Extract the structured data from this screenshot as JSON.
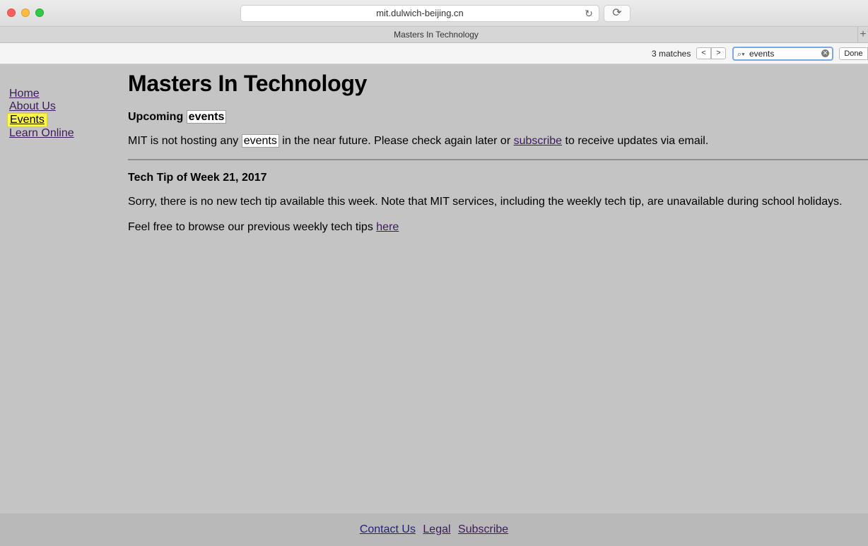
{
  "browser": {
    "url": "mit.dulwich-beijing.cn",
    "tab_title": "Masters In Technology",
    "new_tab_label": "+",
    "find": {
      "matches_text": "3 matches",
      "prev_label": "<",
      "next_label": ">",
      "query": "events",
      "done_label": "Done"
    }
  },
  "sidebar": {
    "items": [
      {
        "label": "Home"
      },
      {
        "label": "About Us"
      },
      {
        "label": "Events"
      },
      {
        "label": "Learn Online"
      }
    ]
  },
  "main": {
    "title": "Masters In Technology",
    "upcoming_heading_prefix": "Upcoming",
    "upcoming_heading_highlight": "events",
    "nohost_part1": "MIT is not hosting any",
    "nohost_highlight": "events",
    "nohost_part2": "in the near future. Please check again later or",
    "subscribe_link": "subscribe",
    "nohost_part3": "to receive updates via email.",
    "tip_heading": "Tech Tip of Week 21, 2017",
    "sorry_text": "Sorry, there is no new tech tip available this week. Note that MIT services, including the weekly tech tip, are unavailable during school holidays.",
    "browse_text": "Feel free to browse our previous weekly tech tips",
    "here_link": "here"
  },
  "footer": {
    "links": [
      {
        "label": "Contact Us"
      },
      {
        "label": "Legal"
      },
      {
        "label": "Subscribe"
      }
    ]
  }
}
